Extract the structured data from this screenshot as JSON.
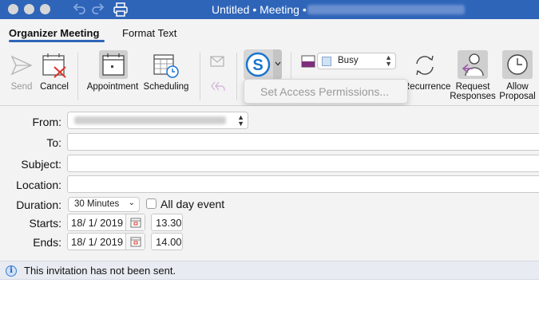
{
  "window": {
    "title": "Untitled • Meeting •"
  },
  "tabs": [
    {
      "label": "Organizer Meeting",
      "active": true
    },
    {
      "label": "Format Text",
      "active": false
    }
  ],
  "ribbon": {
    "send_label": "Send",
    "cancel_label": "Cancel",
    "appointment_label": "Appointment",
    "scheduling_label": "Scheduling",
    "show_as_value": "Busy",
    "recurrence_label": "Recurrence",
    "request_responses_label_1": "Request",
    "request_responses_label_2": "Responses",
    "allow_proposal_label_1": "Allow",
    "allow_proposal_label_2": "Proposal"
  },
  "popup": {
    "item": "Set Access Permissions..."
  },
  "form": {
    "from_label": "From:",
    "to_label": "To:",
    "subject_label": "Subject:",
    "location_label": "Location:",
    "duration_label": "Duration:",
    "duration_value": "30 Minutes",
    "all_day_label": "All day event",
    "starts_label": "Starts:",
    "start_date": "18/  1/ 2019",
    "start_time": "13.30",
    "ends_label": "Ends:",
    "end_date": "18/  1/ 2019",
    "end_time": "14.00"
  },
  "status": {
    "message": "This invitation has not been sent."
  },
  "colors": {
    "accent": "#2f65b9",
    "cancel_x": "#d9342b",
    "skype": "#1a75cf"
  }
}
